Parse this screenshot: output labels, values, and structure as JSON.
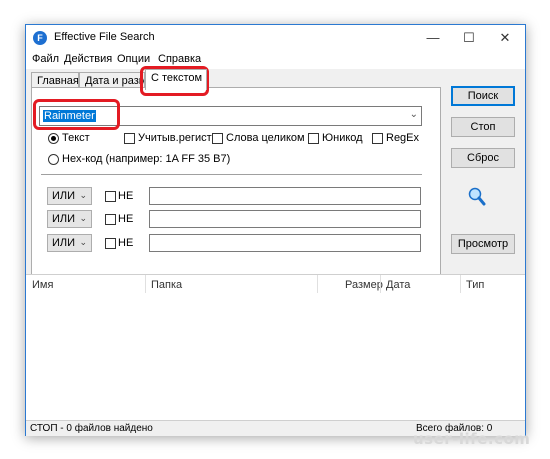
{
  "window": {
    "title": "Effective File Search",
    "controls": {
      "minimize": "—",
      "maximize": "☐",
      "close": "✕"
    }
  },
  "menu": [
    {
      "label": "Файл"
    },
    {
      "label": "Действия"
    },
    {
      "label": "Опции"
    },
    {
      "label": "Справка"
    }
  ],
  "tabs": [
    {
      "label": "Главная"
    },
    {
      "label": "Дата и разме"
    },
    {
      "label": "С текстом"
    }
  ],
  "search": {
    "value": "Rainmeter",
    "mode_text": "Текст",
    "mode_hex": "Hex-код (например: 1A FF 35 B7)",
    "opt_case": "Учитыв.регистр",
    "opt_whole": "Слова целиком",
    "opt_unicode": "Юникод",
    "opt_regex": "RegEx"
  },
  "conditions": [
    {
      "op": "ИЛИ",
      "not": "НЕ",
      "value": ""
    },
    {
      "op": "ИЛИ",
      "not": "НЕ",
      "value": ""
    },
    {
      "op": "ИЛИ",
      "not": "НЕ",
      "value": ""
    }
  ],
  "buttons": {
    "search": "Поиск",
    "stop": "Стоп",
    "reset": "Сброс",
    "preview": "Просмотр"
  },
  "results": {
    "columns": [
      "Имя",
      "Папка",
      "Размер",
      "Дата",
      "Тип"
    ]
  },
  "status": {
    "left": "СТОП - 0 файлов найдено",
    "right": "Всего файлов: 0"
  },
  "watermark": "user-life.com",
  "colors": {
    "highlight": "#e31b23",
    "selection": "#0078d7"
  }
}
